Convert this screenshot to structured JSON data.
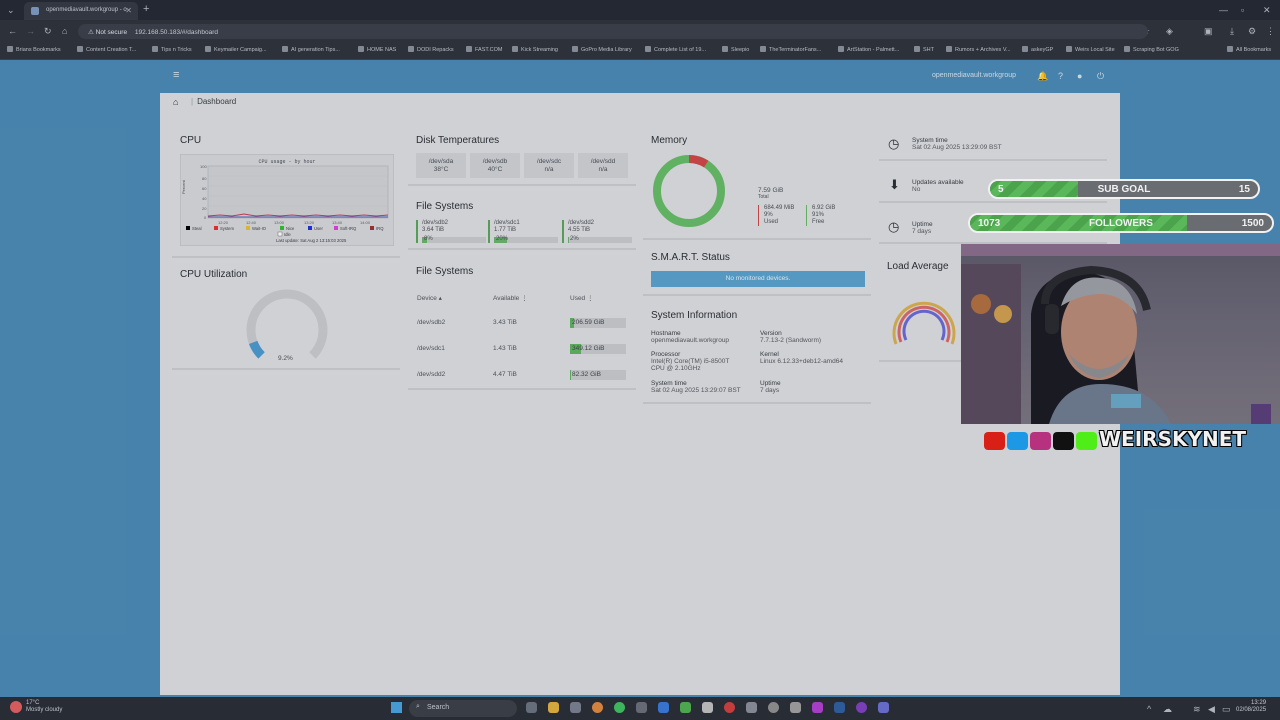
{
  "browser": {
    "tab_title": "openmediavault.workgroup - o",
    "url_prefix": "Not secure",
    "url": "192.168.50.183/#/dashboard"
  },
  "bookmarks": [
    "Brians Bookmarks",
    "Content Creation T...",
    "Tips n Tricks",
    "Keymailer Campaig...",
    "AI generation Tips...",
    "HOME NAS",
    "DODI Repacks",
    "FAST.COM",
    "Kick Streaming",
    "GoPro Media Library",
    "Complete List of 19...",
    "Sleepio",
    "TheTerminatorFans...",
    "ArtStation - Palmett...",
    "SHT",
    "Rumors + Archives V...",
    "askeyGP",
    "Weirs Local Site",
    "Scraping Bot GOG",
    "All Bookmarks"
  ],
  "app": {
    "hostname": "openmediavault.workgroup",
    "breadcrumb": "Dashboard"
  },
  "cpu": {
    "title": "CPU",
    "graph_title": "CPU usage - by hour",
    "ylabel": "Percent",
    "legend": [
      "Steal",
      "System",
      "Wait-IO",
      "Nice",
      "User",
      "Soft-IRQ",
      "IRQ",
      "Idle"
    ],
    "last_update": "Last update: Sat Aug  2 13:15:03 2025",
    "legend_colors": [
      "#000000",
      "#e83030",
      "#e8c030",
      "#30c030",
      "#2030e0",
      "#e040e0",
      "#a03030",
      "#ffffff"
    ]
  },
  "cpu_util": {
    "title": "CPU Utilization",
    "value_label": "9.2%",
    "value": 9.2
  },
  "disk_temps": {
    "title": "Disk Temperatures",
    "items": [
      {
        "dev": "/dev/sda",
        "temp": "38°C"
      },
      {
        "dev": "/dev/sdb",
        "temp": "40°C"
      },
      {
        "dev": "/dev/sdc",
        "temp": "n/a"
      },
      {
        "dev": "/dev/sdd",
        "temp": "n/a"
      }
    ]
  },
  "fs_summary": {
    "title": "File Systems",
    "items": [
      {
        "dev": "/dev/sdb2",
        "total": "3.64 TiB",
        "pct": "8%",
        "fill": 8
      },
      {
        "dev": "/dev/sdc1",
        "total": "1.77 TiB",
        "pct": "20%",
        "fill": 20
      },
      {
        "dev": "/dev/sdd2",
        "total": "4.55 TiB",
        "pct": "2%",
        "fill": 2
      }
    ]
  },
  "fs_table": {
    "title": "File Systems",
    "cols": [
      "Device",
      "Available",
      "Used"
    ],
    "rows": [
      {
        "dev": "/dev/sdb2",
        "avail": "3.43 TiB",
        "used": "206.59 GiB",
        "fill": 8
      },
      {
        "dev": "/dev/sdc1",
        "avail": "1.43 TiB",
        "used": "349.12 GiB",
        "fill": 20
      },
      {
        "dev": "/dev/sdd2",
        "avail": "4.47 TiB",
        "used": "82.32 GiB",
        "fill": 2
      }
    ]
  },
  "memory": {
    "title": "Memory",
    "total": "7.59 GiB",
    "total_label": "Total",
    "used": "684.49 MiB",
    "used_pct": "9%",
    "used_label": "Used",
    "free": "6.92 GiB",
    "free_pct": "91%",
    "free_label": "Free",
    "used_fraction": 9
  },
  "smart": {
    "title": "S.M.A.R.T. Status",
    "message": "No monitored devices."
  },
  "sysinfo": {
    "title": "System Information",
    "hostname_label": "Hostname",
    "hostname": "openmediavault.workgroup",
    "version_label": "Version",
    "version": "7.7.13-2 (Sandworm)",
    "processor_label": "Processor",
    "processor_1": "Intel(R) Core(TM) i5-8500T",
    "processor_2": "CPU @ 2.10GHz",
    "kernel_label": "Kernel",
    "kernel": "Linux 6.12.33+deb12-amd64",
    "time_label": "System time",
    "time": "Sat 02 Aug 2025 13:29:07 BST",
    "uptime_label": "Uptime",
    "uptime": "7 days"
  },
  "right": {
    "systime_label": "System time",
    "systime": "Sat 02 Aug 2025 13:29:09 BST",
    "updates_label": "Updates available",
    "updates": "No",
    "uptime_label": "Uptime",
    "uptime": "7 days",
    "load_title": "Load Average"
  },
  "overlay": {
    "sub_current": "5",
    "sub_label": "SUB GOAL",
    "sub_target": "15",
    "sub_fraction": 0.33,
    "fol_current": "1073",
    "fol_label": "FOLLOWERS",
    "fol_target": "1500",
    "fol_fraction": 0.72,
    "brand": "WEIRSKYNET"
  },
  "taskbar": {
    "temp": "17°C",
    "weather": "Mostly cloudy",
    "search": "Search",
    "time": "13:29",
    "date": "02/08/2025"
  }
}
